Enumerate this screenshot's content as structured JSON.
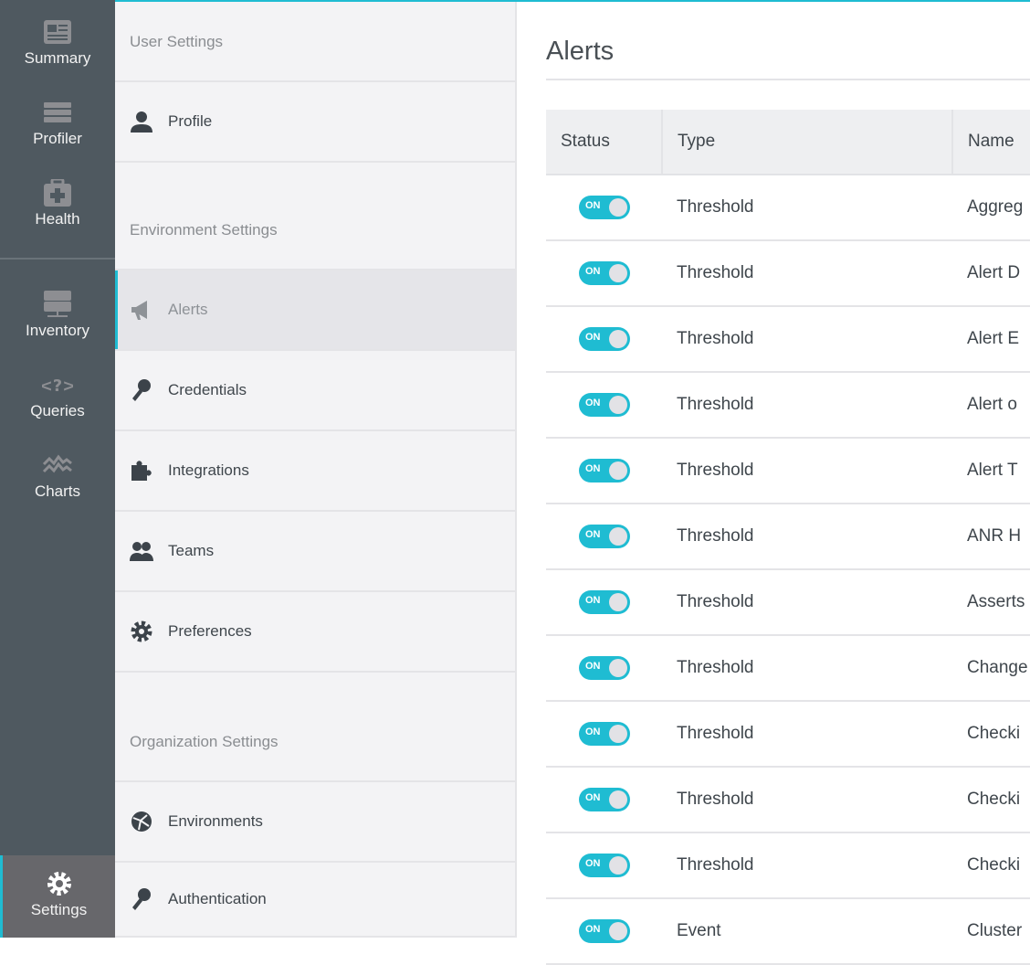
{
  "nav": {
    "items": [
      {
        "label": "Summary",
        "icon": "summary-icon"
      },
      {
        "label": "Profiler",
        "icon": "profiler-icon"
      },
      {
        "label": "Health",
        "icon": "health-icon"
      },
      {
        "label": "Inventory",
        "icon": "inventory-icon"
      },
      {
        "label": "Queries",
        "icon": "queries-icon"
      },
      {
        "label": "Charts",
        "icon": "charts-icon"
      },
      {
        "label": "Settings",
        "icon": "gear-icon",
        "active": true
      }
    ]
  },
  "settings": {
    "user_header": "User Settings",
    "env_header": "Environment Settings",
    "org_header": "Organization Settings",
    "items": [
      "Profile",
      "Alerts",
      "Credentials",
      "Integrations",
      "Teams",
      "Preferences",
      "Environments",
      "Authentication"
    ]
  },
  "main": {
    "title": "Alerts",
    "columns": [
      "Status",
      "Type",
      "Name"
    ],
    "toggle_label": "ON",
    "rows": [
      {
        "type": "Threshold",
        "name": "Aggreg"
      },
      {
        "type": "Threshold",
        "name": "Alert D"
      },
      {
        "type": "Threshold",
        "name": "Alert E"
      },
      {
        "type": "Threshold",
        "name": "Alert o"
      },
      {
        "type": "Threshold",
        "name": "Alert T"
      },
      {
        "type": "Threshold",
        "name": "ANR H"
      },
      {
        "type": "Threshold",
        "name": "Asserts"
      },
      {
        "type": "Threshold",
        "name": "Change"
      },
      {
        "type": "Threshold",
        "name": "Checki"
      },
      {
        "type": "Threshold",
        "name": "Checki"
      },
      {
        "type": "Threshold",
        "name": "Checki"
      },
      {
        "type": "Event",
        "name": "Cluster"
      }
    ]
  },
  "colors": {
    "accent": "#1fbcd2",
    "nav_bg": "#4f5960"
  }
}
